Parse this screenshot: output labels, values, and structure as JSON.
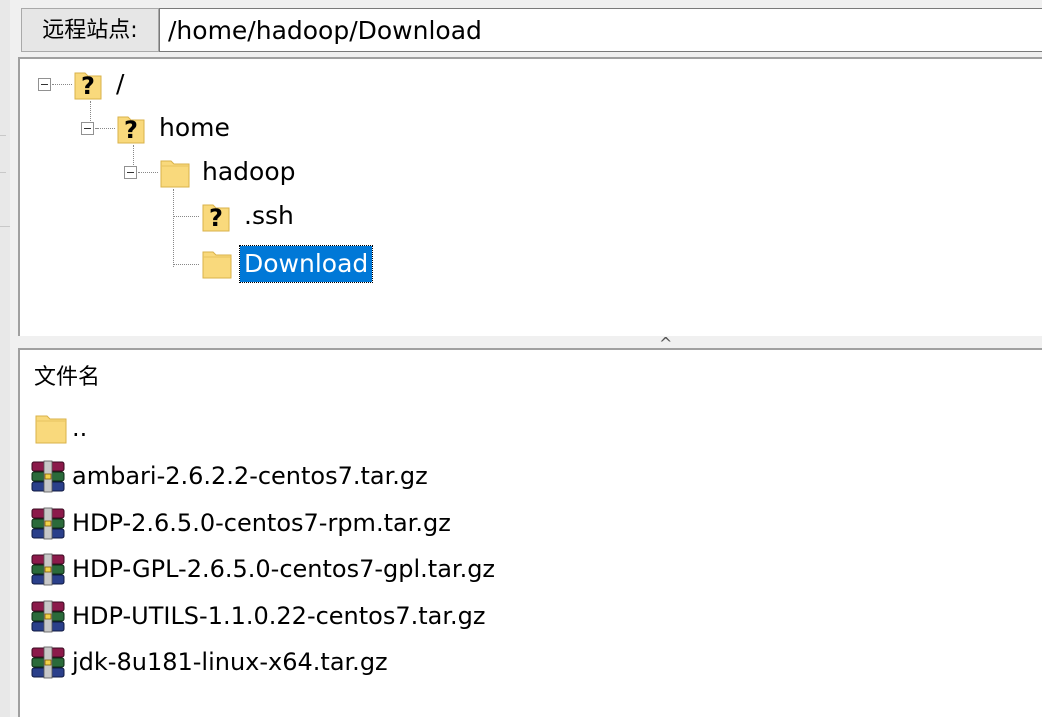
{
  "address_bar": {
    "label": "远程站点:",
    "path": "/home/hadoop/Download"
  },
  "tree": {
    "nodes": [
      {
        "label": "/",
        "icon": "question-mark-icon",
        "selected": false
      },
      {
        "label": "home",
        "icon": "question-mark-icon",
        "selected": false
      },
      {
        "label": "hadoop",
        "icon": "folder-icon",
        "selected": false
      },
      {
        "label": ".ssh",
        "icon": "question-mark-icon",
        "selected": false
      },
      {
        "label": "Download",
        "icon": "folder-icon",
        "selected": true
      }
    ]
  },
  "file_list": {
    "column_header": "文件名",
    "files": [
      {
        "name": "..",
        "icon": "folder-icon"
      },
      {
        "name": "ambari-2.6.2.2-centos7.tar.gz",
        "icon": "archive-icon"
      },
      {
        "name": "HDP-2.6.5.0-centos7-rpm.tar.gz",
        "icon": "archive-icon"
      },
      {
        "name": "HDP-GPL-2.6.5.0-centos7-gpl.tar.gz",
        "icon": "archive-icon"
      },
      {
        "name": "HDP-UTILS-1.1.0.22-centos7.tar.gz",
        "icon": "archive-icon"
      },
      {
        "name": "jdk-8u181-linux-x64.tar.gz",
        "icon": "archive-icon"
      }
    ]
  },
  "colors": {
    "selection": "#0078d7",
    "folder": "#f9d97c"
  }
}
